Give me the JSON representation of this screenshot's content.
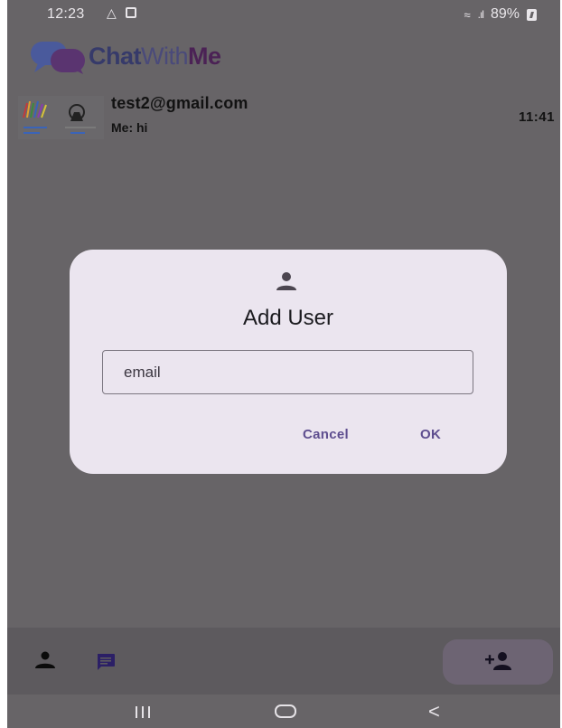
{
  "status_bar": {
    "time": "12:23",
    "battery": "89%"
  },
  "app": {
    "logo_part1": "Chat",
    "logo_part2": "With",
    "logo_part3": "Me"
  },
  "chats": [
    {
      "name": "test2@gmail.com",
      "preview": "Me: hi",
      "time": "11:41"
    }
  ],
  "dialog": {
    "icon": "person-icon",
    "title": "Add User",
    "input_placeholder": "email",
    "input_value": "",
    "cancel_label": "Cancel",
    "ok_label": "OK"
  },
  "bottom_bar": {
    "tabs": [
      "person-icon",
      "chat-icon"
    ],
    "fab_icon": "person-add-icon"
  },
  "colors": {
    "scrim": "#676467",
    "dialog_bg": "#ebe5ef",
    "accent": "#5e4e8f",
    "fab_bg": "#6d6473"
  }
}
